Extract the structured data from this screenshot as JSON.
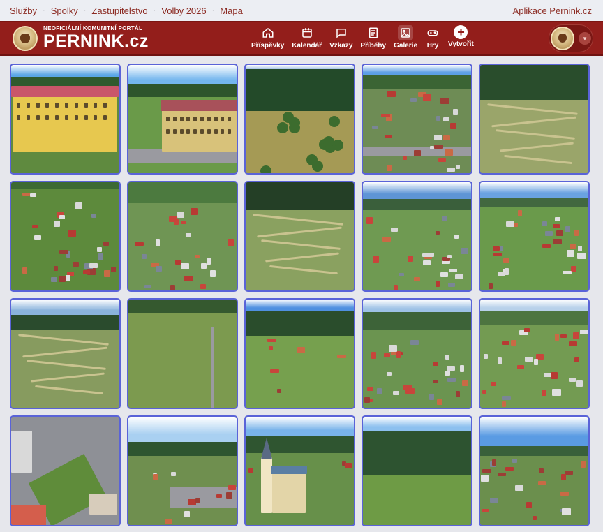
{
  "topnav": {
    "links": [
      "Služby",
      "Spolky",
      "Zastupitelstvo",
      "Volby 2026",
      "Mapa"
    ],
    "apps_label": "Aplikace Pernink.cz"
  },
  "brand": {
    "subtitle": "NEOFICIÁLNÍ KOMUNITNÍ PORTÁL",
    "name": "PERNINK.cz"
  },
  "nav": {
    "items": [
      {
        "label": "Příspěvky",
        "icon": "home-icon"
      },
      {
        "label": "Kalendář",
        "icon": "calendar-icon"
      },
      {
        "label": "Vzkazy",
        "icon": "message-icon"
      },
      {
        "label": "Příběhy",
        "icon": "book-icon"
      },
      {
        "label": "Galerie",
        "icon": "image-icon",
        "active": true
      },
      {
        "label": "Hry",
        "icon": "gamepad-icon"
      },
      {
        "label": "Vytvořit",
        "icon": "plus-icon"
      }
    ]
  },
  "colors": {
    "header_bg": "#931e1b",
    "top_text": "#8b2a22",
    "tile_border": "#5a63d8",
    "page_bg": "#e6e7ec"
  },
  "gallery": {
    "tiles": [
      {
        "kind": "school"
      },
      {
        "kind": "school-wide"
      },
      {
        "kind": "forest-meadow"
      },
      {
        "kind": "village-center"
      },
      {
        "kind": "ski-slope"
      },
      {
        "kind": "village-aerial"
      },
      {
        "kind": "village-valley"
      },
      {
        "kind": "ski-slope-2"
      },
      {
        "kind": "village-panorama"
      },
      {
        "kind": "village-panorama-2"
      },
      {
        "kind": "slope-hills"
      },
      {
        "kind": "lift-slope"
      },
      {
        "kind": "church-slope"
      },
      {
        "kind": "valley-village"
      },
      {
        "kind": "village-hills"
      },
      {
        "kind": "square-top"
      },
      {
        "kind": "street-houses"
      },
      {
        "kind": "church"
      },
      {
        "kind": "meadow-trees"
      },
      {
        "kind": "village-sky"
      }
    ]
  }
}
